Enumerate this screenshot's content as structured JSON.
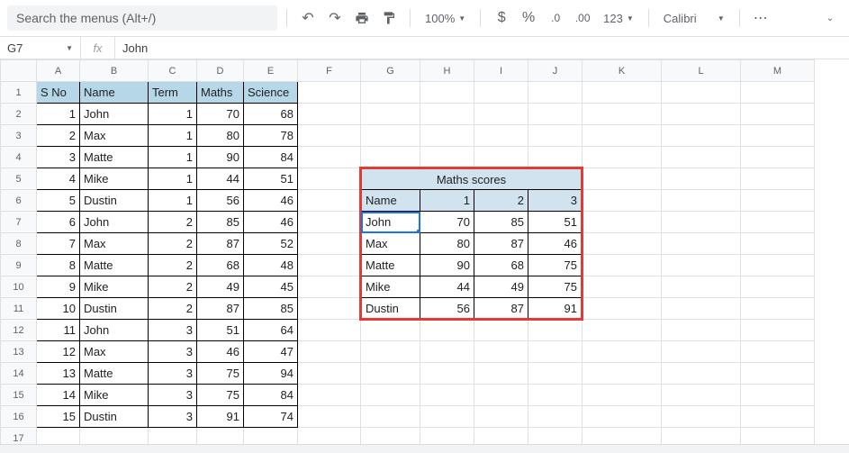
{
  "toolbar": {
    "search_placeholder": "Search the menus (Alt+/)",
    "zoom": "100%",
    "font": "Calibri"
  },
  "namebox": "G7",
  "formula_value": "John",
  "columns": [
    "A",
    "B",
    "C",
    "D",
    "E",
    "F",
    "G",
    "H",
    "I",
    "J",
    "K",
    "L",
    "M"
  ],
  "rows": [
    1,
    2,
    3,
    4,
    5,
    6,
    7,
    8,
    9,
    10,
    11,
    12,
    13,
    14,
    15,
    16,
    17
  ],
  "main_headers": {
    "sno": "S No",
    "name": "Name",
    "term": "Term",
    "maths": "Maths",
    "science": "Science"
  },
  "main_data": [
    {
      "sno": 1,
      "name": "John",
      "term": 1,
      "maths": 70,
      "science": 68
    },
    {
      "sno": 2,
      "name": "Max",
      "term": 1,
      "maths": 80,
      "science": 78
    },
    {
      "sno": 3,
      "name": "Matte",
      "term": 1,
      "maths": 90,
      "science": 84
    },
    {
      "sno": 4,
      "name": "Mike",
      "term": 1,
      "maths": 44,
      "science": 51
    },
    {
      "sno": 5,
      "name": "Dustin",
      "term": 1,
      "maths": 56,
      "science": 46
    },
    {
      "sno": 6,
      "name": "John",
      "term": 2,
      "maths": 85,
      "science": 46
    },
    {
      "sno": 7,
      "name": "Max",
      "term": 2,
      "maths": 87,
      "science": 52
    },
    {
      "sno": 8,
      "name": "Matte",
      "term": 2,
      "maths": 68,
      "science": 48
    },
    {
      "sno": 9,
      "name": "Mike",
      "term": 2,
      "maths": 49,
      "science": 45
    },
    {
      "sno": 10,
      "name": "Dustin",
      "term": 2,
      "maths": 87,
      "science": 85
    },
    {
      "sno": 11,
      "name": "John",
      "term": 3,
      "maths": 51,
      "science": 64
    },
    {
      "sno": 12,
      "name": "Max",
      "term": 3,
      "maths": 46,
      "science": 47
    },
    {
      "sno": 13,
      "name": "Matte",
      "term": 3,
      "maths": 75,
      "science": 94
    },
    {
      "sno": 14,
      "name": "Mike",
      "term": 3,
      "maths": 75,
      "science": 84
    },
    {
      "sno": 15,
      "name": "Dustin",
      "term": 3,
      "maths": 91,
      "science": 74
    }
  ],
  "pivot": {
    "title": "Maths scores",
    "name_hdr": "Name",
    "col_hdrs": [
      "1",
      "2",
      "3"
    ],
    "rows": [
      {
        "name": "John",
        "v": [
          70,
          85,
          51
        ]
      },
      {
        "name": "Max",
        "v": [
          80,
          87,
          46
        ]
      },
      {
        "name": "Matte",
        "v": [
          90,
          68,
          75
        ]
      },
      {
        "name": "Mike",
        "v": [
          44,
          49,
          75
        ]
      },
      {
        "name": "Dustin",
        "v": [
          56,
          87,
          91
        ]
      }
    ]
  },
  "chart_data": {
    "type": "table",
    "title": "Maths scores",
    "categories": [
      "1",
      "2",
      "3"
    ],
    "series": [
      {
        "name": "John",
        "values": [
          70,
          85,
          51
        ]
      },
      {
        "name": "Max",
        "values": [
          80,
          87,
          46
        ]
      },
      {
        "name": "Matte",
        "values": [
          90,
          68,
          75
        ]
      },
      {
        "name": "Mike",
        "values": [
          44,
          49,
          75
        ]
      },
      {
        "name": "Dustin",
        "values": [
          56,
          87,
          91
        ]
      }
    ]
  }
}
